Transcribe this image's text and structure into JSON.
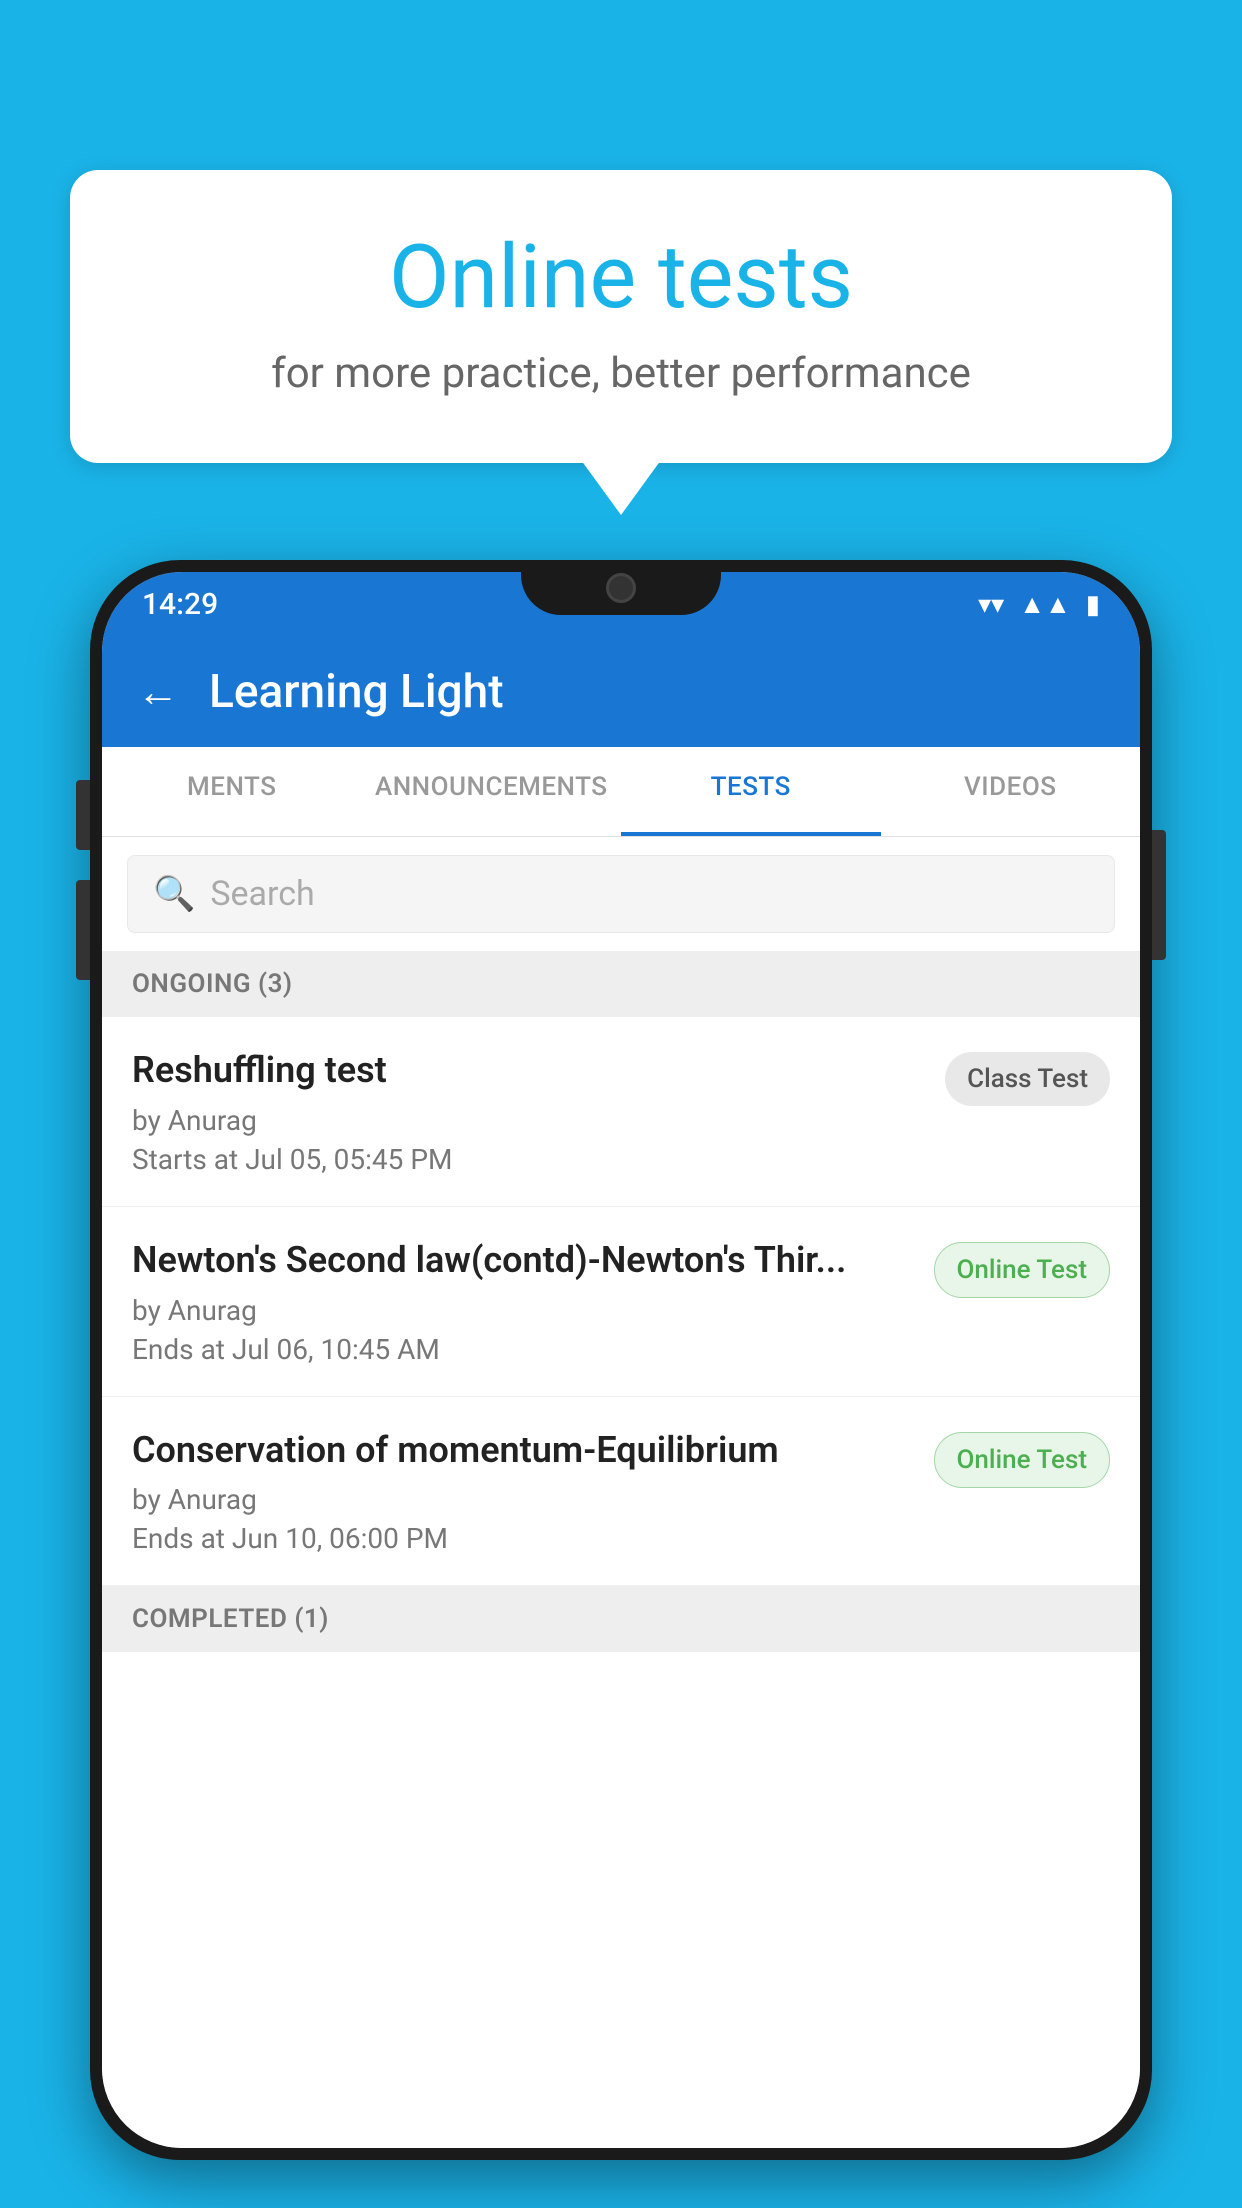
{
  "background": {
    "color": "#1ab3e8"
  },
  "speech_bubble": {
    "title": "Online tests",
    "subtitle": "for more practice, better performance"
  },
  "phone": {
    "status_bar": {
      "time": "14:29",
      "wifi_icon": "▾",
      "signal_icon": "▲",
      "battery_icon": "▮"
    },
    "app_bar": {
      "back_label": "←",
      "title": "Learning Light"
    },
    "tabs": [
      {
        "label": "MENTS",
        "active": false
      },
      {
        "label": "ANNOUNCEMENTS",
        "active": false
      },
      {
        "label": "TESTS",
        "active": true
      },
      {
        "label": "VIDEOS",
        "active": false
      }
    ],
    "search": {
      "placeholder": "Search"
    },
    "ongoing_section": {
      "header": "ONGOING (3)"
    },
    "tests": [
      {
        "name": "Reshuffling test",
        "author": "by Anurag",
        "time_label": "Starts at",
        "time": "Jul 05, 05:45 PM",
        "badge": "Class Test",
        "badge_type": "class"
      },
      {
        "name": "Newton's Second law(contd)-Newton's Thir...",
        "author": "by Anurag",
        "time_label": "Ends at",
        "time": "Jul 06, 10:45 AM",
        "badge": "Online Test",
        "badge_type": "online"
      },
      {
        "name": "Conservation of momentum-Equilibrium",
        "author": "by Anurag",
        "time_label": "Ends at",
        "time": "Jun 10, 06:00 PM",
        "badge": "Online Test",
        "badge_type": "online"
      }
    ],
    "completed_section": {
      "header": "COMPLETED (1)"
    }
  }
}
